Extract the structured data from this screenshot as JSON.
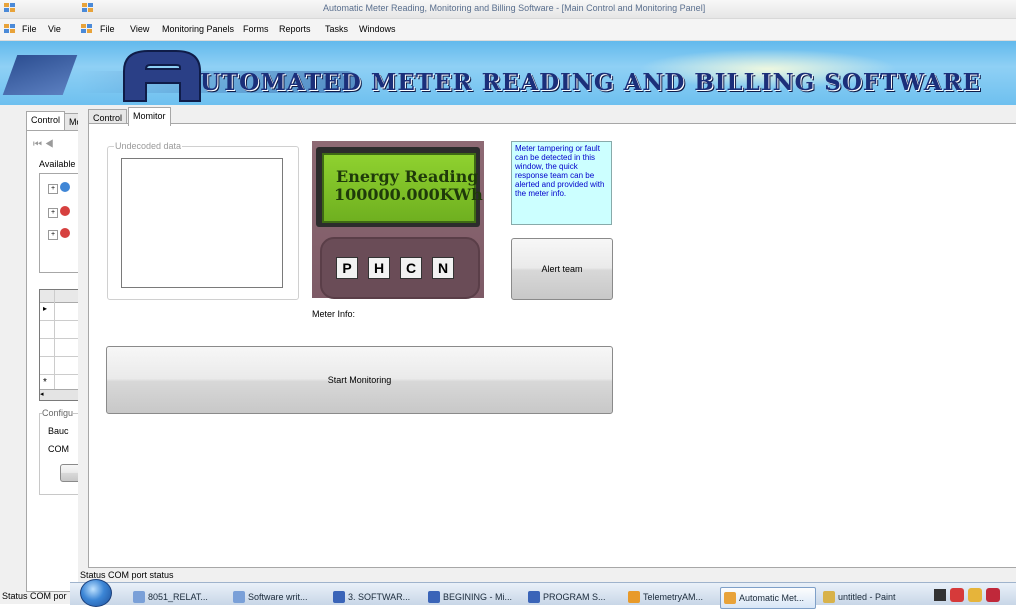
{
  "back_window": {
    "menu": [
      "File",
      "Vie"
    ],
    "tabs": [
      "Control",
      "Mo"
    ],
    "available_label": "Available",
    "config_group": "Configu",
    "baud_label": "Bauc",
    "com_label": "COM",
    "grid_row_marker": "▸",
    "grid_new_marker": "*"
  },
  "app": {
    "title": "Automatic Meter Reading, Monitoring and Billing Software - [Main Control and Monitoring Panel]",
    "menu": [
      "File",
      "View",
      "Monitoring Panels",
      "Forms",
      "Reports",
      "Tasks",
      "Windows"
    ],
    "banner_text": "UTOMATED METER READING AND BILLING SOFTWARE",
    "tabs": [
      "Control",
      "Momitor"
    ]
  },
  "monitor": {
    "undecoded_label": "Undecoded data",
    "lcd_line1": "Energy Reading",
    "lcd_line2": "100000.000KWh",
    "keys": [
      "P",
      "H",
      "C",
      "N"
    ],
    "info_text": "Meter tampering or fault can be detected in this window, the quick response team can be alerted and provided with the meter info.",
    "alert_button": "Alert team",
    "meter_info_label": "Meter Info:",
    "start_button": "Start Monitoring"
  },
  "status": {
    "inner": "Status  COM port status",
    "outer": "Status  COM por"
  },
  "taskbar": {
    "items": [
      {
        "label": "8051_RELAT...",
        "icon": "#7aa0d8"
      },
      {
        "label": "Software writ...",
        "icon": "#7aa0d8"
      },
      {
        "label": "3. SOFTWAR...",
        "icon": "#3a64b8"
      },
      {
        "label": "BEGINING - Mi...",
        "icon": "#3a64b8"
      },
      {
        "label": "PROGRAM S...",
        "icon": "#3a64b8"
      },
      {
        "label": "TelemetryAM...",
        "icon": "#e89a2a"
      },
      {
        "label": "Automatic Met...",
        "icon": "#e8a33a",
        "active": true
      },
      {
        "label": "untitled - Paint",
        "icon": "#d8b24a"
      }
    ]
  },
  "colors": {
    "banner": "#6ec0ef",
    "lcd_green": "#7fbf2a",
    "info_bg": "#ccffff",
    "info_text": "#0000cc",
    "meter_panel": "#8e6a74"
  }
}
